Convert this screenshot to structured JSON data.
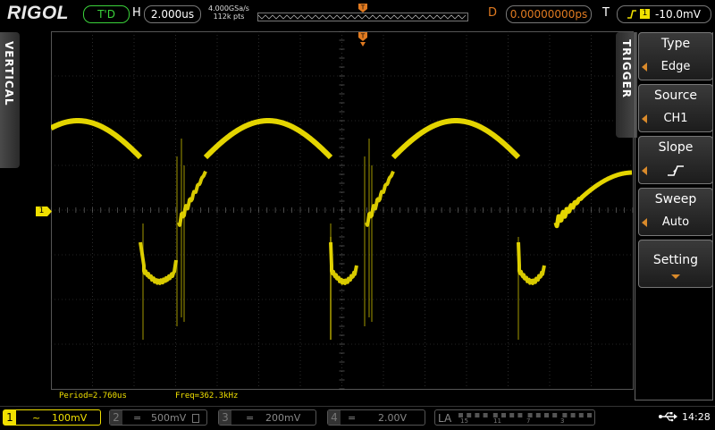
{
  "brand": "RIGOL",
  "top": {
    "run_state": "T'D",
    "h_label": "H",
    "timebase": "2.000us",
    "sample_rate": "4.000GSa/s",
    "memory_depth": "112k pts",
    "d_label": "D",
    "delay": "0.00000000ps",
    "t_label": "T",
    "trigger_channel": "1",
    "trigger_level": "-10.0mV"
  },
  "side_labels": {
    "vertical": "VERTICAL",
    "trigger": "TRIGGER"
  },
  "trigger_menu": [
    {
      "title": "Type",
      "value": "Edge"
    },
    {
      "title": "Source",
      "value": "CH1"
    },
    {
      "title": "Slope",
      "value": ""
    },
    {
      "title": "Sweep",
      "value": "Auto"
    },
    {
      "title": "Setting",
      "value": ""
    }
  ],
  "measurements": {
    "period": "Period=2.760us",
    "freq": "Freq=362.3kHz"
  },
  "channels": [
    {
      "num": "1",
      "scale": "100mV",
      "active": true,
      "coupling": "~"
    },
    {
      "num": "2",
      "scale": "500mV",
      "active": false,
      "coupling": "="
    },
    {
      "num": "3",
      "scale": "200mV",
      "active": false,
      "coupling": "="
    },
    {
      "num": "4",
      "scale": "2.00V",
      "active": false,
      "coupling": "="
    }
  ],
  "la": {
    "label": "LA",
    "ticks": [
      "15",
      "11",
      "7",
      "3"
    ]
  },
  "clock": "14:28",
  "colors": {
    "ch1": "#f0e000",
    "accent": "#e07a20",
    "grid": "#4a4a4a",
    "green": "#3ad23a"
  },
  "icons": [
    "usb-icon",
    "trigger-edge-icon",
    "rising-slope-icon",
    "ch1-ground-marker-icon",
    "trigger-position-icon"
  ]
}
